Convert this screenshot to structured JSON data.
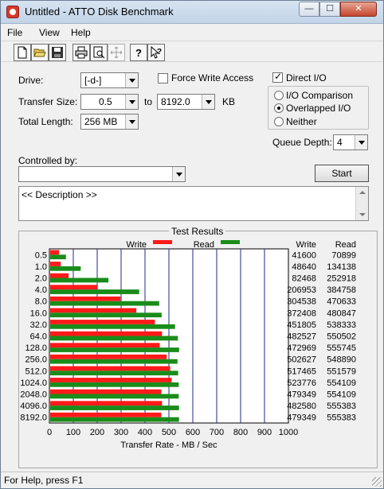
{
  "window": {
    "title": "Untitled - ATTO Disk Benchmark"
  },
  "window_buttons": {
    "minimize": "—",
    "maximize": "☐",
    "close": "✕"
  },
  "menu": [
    "File",
    "View",
    "Help"
  ],
  "toolbar_icons": [
    "new-document-icon",
    "open-folder-icon",
    "save-icon",
    "print-icon",
    "print-preview-icon",
    "move-icon",
    "help-icon",
    "context-help-icon"
  ],
  "form": {
    "drive_label": "Drive:",
    "drive_value": "[-d-]",
    "force_write_label": "Force Write Access",
    "force_write_checked": false,
    "transfer_size_label": "Transfer Size:",
    "transfer_from": "0.5",
    "to_label": "to",
    "transfer_to": "8192.0",
    "kb_label": "KB",
    "total_length_label": "Total Length:",
    "total_length_value": "256 MB",
    "direct_io_label": "Direct I/O",
    "direct_io_checked": true,
    "io_options": [
      "I/O Comparison",
      "Overlapped I/O",
      "Neither"
    ],
    "io_selected": "Overlapped I/O",
    "queue_depth_label": "Queue Depth:",
    "queue_depth_value": "4",
    "controlled_by_label": "Controlled by:",
    "controlled_by_value": "",
    "start_label": "Start",
    "description_text": "<< Description >>"
  },
  "results": {
    "title": "Test Results",
    "legend_write": "Write",
    "legend_read": "Read",
    "col_write": "Write",
    "col_read": "Read",
    "xlabel": "Transfer Rate - MB / Sec",
    "colors": {
      "write": "#ff1a1a",
      "read": "#1a8c1a",
      "grid": "#1e2a8a"
    }
  },
  "chart_data": {
    "type": "bar",
    "orientation": "horizontal",
    "categories": [
      "0.5",
      "1.0",
      "2.0",
      "4.0",
      "8.0",
      "16.0",
      "32.0",
      "64.0",
      "128.0",
      "256.0",
      "512.0",
      "1024.0",
      "2048.0",
      "4096.0",
      "8192.0"
    ],
    "series": [
      {
        "name": "Write",
        "values": [
          41600,
          48640,
          82468,
          206953,
          304538,
          372408,
          451805,
          482527,
          472969,
          502627,
          517465,
          523776,
          479349,
          482580,
          479349
        ]
      },
      {
        "name": "Read",
        "values": [
          70899,
          134138,
          252918,
          384758,
          470633,
          480847,
          538333,
          550502,
          555745,
          548890,
          551579,
          554109,
          554109,
          555383,
          555383
        ]
      }
    ],
    "xlabel": "Transfer Rate - MB / Sec",
    "xlim": [
      0,
      1000
    ],
    "x_ticks": [
      "0",
      "100",
      "200",
      "300",
      "400",
      "500",
      "600",
      "700",
      "800",
      "900",
      "1000"
    ],
    "grid": true,
    "legend": "top"
  },
  "status": {
    "text": "For Help, press F1"
  }
}
